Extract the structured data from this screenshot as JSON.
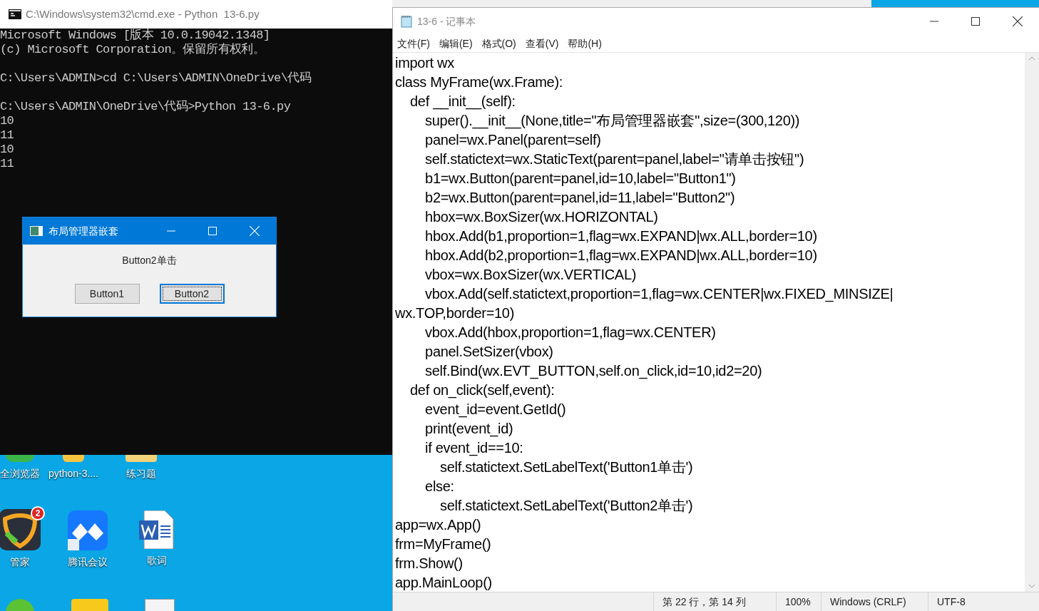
{
  "console": {
    "title": "C:\\Windows\\system32\\cmd.exe - Python  13-6.py",
    "blocks": [
      [
        "Microsoft Windows [版本 10.0.19042.1348]",
        "(c) Microsoft Corporation。保留所有权利。"
      ],
      [
        "C:\\Users\\ADMIN>cd C:\\Users\\ADMIN\\OneDrive\\代码"
      ],
      [
        "C:\\Users\\ADMIN\\OneDrive\\代码>Python 13-6.py",
        "10",
        "11",
        "10",
        "11"
      ]
    ]
  },
  "dialog": {
    "title": "布局管理器嵌套",
    "label": "Button2单击",
    "buttons": [
      {
        "label": "Button1",
        "focused": false
      },
      {
        "label": "Button2",
        "focused": true
      }
    ]
  },
  "desktop_icons": [
    {
      "kind": "browser",
      "label": "全浏览器"
    },
    {
      "kind": "python",
      "label": "python-3...."
    },
    {
      "kind": "folder",
      "label": "练习题"
    },
    {
      "kind": "shield",
      "label": "管家",
      "badge": "2"
    },
    {
      "kind": "meeting",
      "label": "腾讯会议"
    },
    {
      "kind": "word",
      "label": "歌词"
    },
    {
      "kind": "green"
    },
    {
      "kind": "yellow"
    },
    {
      "kind": "document"
    }
  ],
  "notepad": {
    "title": "13-6 - 记事本",
    "menu": [
      "文件(F)",
      "编辑(E)",
      "格式(O)",
      "查看(V)",
      "帮助(H)"
    ],
    "lines": [
      "import wx",
      "class MyFrame(wx.Frame):",
      "    def __init__(self):",
      "        super().__init__(None,title=\"布局管理器嵌套\",size=(300,120))",
      "        panel=wx.Panel(parent=self)",
      "        self.statictext=wx.StaticText(parent=panel,label=\"请单击按钮\")",
      "        b1=wx.Button(parent=panel,id=10,label=\"Button1\")",
      "        b2=wx.Button(parent=panel,id=11,label=\"Button2\")",
      "        hbox=wx.BoxSizer(wx.HORIZONTAL)",
      "        hbox.Add(b1,proportion=1,flag=wx.EXPAND|wx.ALL,border=10)",
      "        hbox.Add(b2,proportion=1,flag=wx.EXPAND|wx.ALL,border=10)",
      "        vbox=wx.BoxSizer(wx.VERTICAL)",
      "        vbox.Add(self.statictext,proportion=1,flag=wx.CENTER|wx.FIXED_MINSIZE|",
      "wx.TOP,border=10)",
      "        vbox.Add(hbox,proportion=1,flag=wx.CENTER)",
      "        panel.SetSizer(vbox)",
      "        self.Bind(wx.EVT_BUTTON,self.on_click,id=10,id2=20)",
      "    def on_click(self,event):",
      "        event_id=event.GetId()",
      "        print(event_id)",
      "        if event_id==10:",
      "            self.statictext.SetLabelText('Button1单击')",
      "        else:",
      "            self.statictext.SetLabelText('Button2单击')",
      "app=wx.App()",
      "frm=MyFrame()",
      "frm.Show()",
      "app.MainLoop()"
    ],
    "status": [
      "第 22 行，第 14 列",
      "100%",
      "Windows (CRLF)",
      "UTF-8"
    ]
  }
}
